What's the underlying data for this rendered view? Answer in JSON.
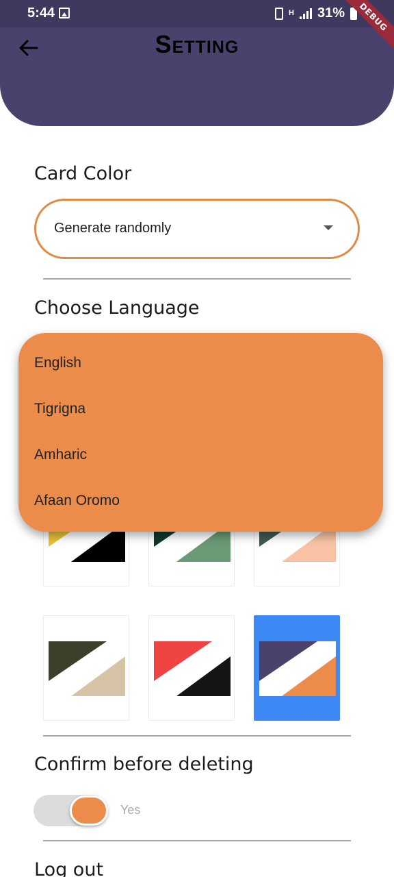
{
  "status_bar": {
    "time": "5:44",
    "network": "H",
    "battery": "31%",
    "debug": "DEBUG"
  },
  "header": {
    "title": "Setting"
  },
  "card_color": {
    "label": "Card Color",
    "dropdown_value": "Generate randomly"
  },
  "language": {
    "label": "Choose Language",
    "options": [
      "English",
      "Tigrigna",
      "Amharic",
      "Afaan Oromo"
    ]
  },
  "color_themes": [
    {
      "top": "#e6c339",
      "bottom": "#000000",
      "selected": false
    },
    {
      "top": "#0f3a2f",
      "bottom": "#6b9a76",
      "selected": false
    },
    {
      "top": "#3f5a55",
      "bottom": "#f8c3a4",
      "selected": false
    },
    {
      "top": "#3c3f2a",
      "bottom": "#d7c4a6",
      "selected": false
    },
    {
      "top": "#f04444",
      "bottom": "#161413",
      "selected": false
    },
    {
      "top": "#4a426d",
      "bottom": "#eb8c4b",
      "selected": true
    }
  ],
  "confirm": {
    "label": "Confirm before deleting",
    "toggle_value": "Yes",
    "enabled": true
  },
  "logout": {
    "label": "Log out"
  },
  "colors": {
    "accent": "#eb8c4b",
    "primary": "#4a426d",
    "selected": "#3d8af7"
  }
}
